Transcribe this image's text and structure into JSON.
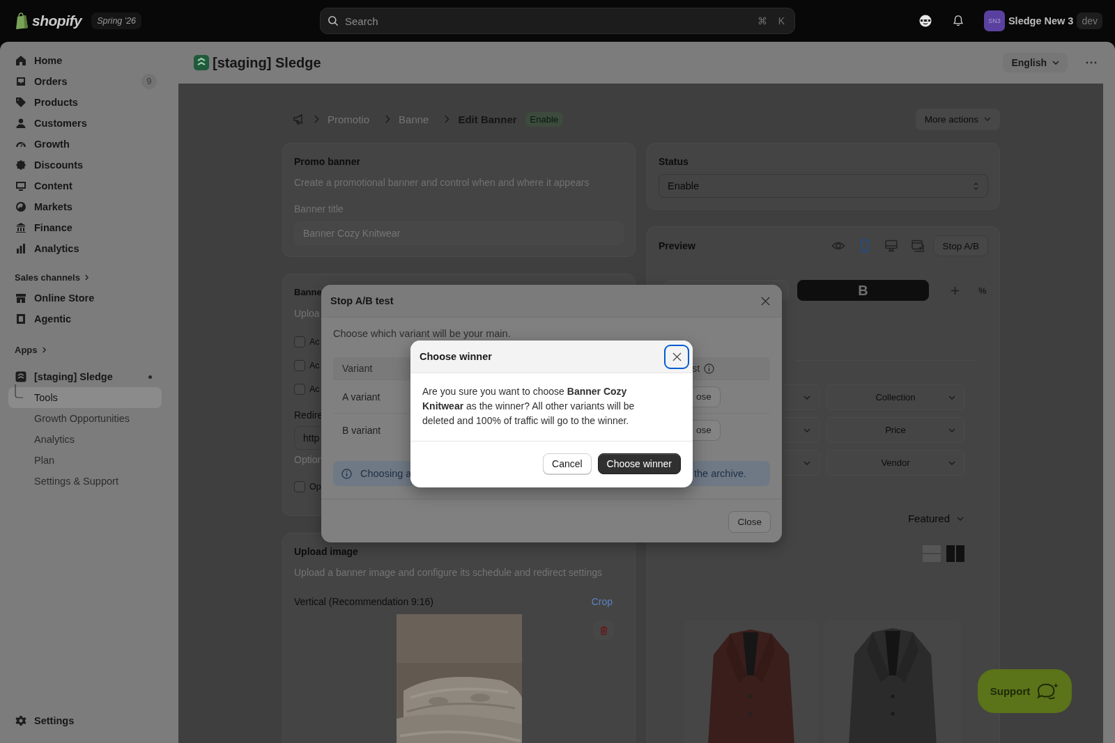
{
  "topbar": {
    "logo": "shopify",
    "edition": "Spring '26",
    "search": {
      "placeholder": "Search"
    },
    "shortcut": [
      "⌘",
      "K"
    ],
    "store": {
      "initials": "SN3",
      "name": "Sledge New 3",
      "badge": "dev"
    }
  },
  "sidebar": {
    "nav": [
      {
        "label": "Home",
        "selected": false
      },
      {
        "label": "Orders",
        "badge": "9",
        "selected": false
      },
      {
        "label": "Products",
        "selected": false
      },
      {
        "label": "Customers",
        "selected": false
      },
      {
        "label": "Growth",
        "selected": false
      },
      {
        "label": "Discounts",
        "selected": false
      },
      {
        "label": "Content",
        "selected": false
      },
      {
        "label": "Markets",
        "selected": false
      },
      {
        "label": "Finance",
        "selected": false
      },
      {
        "label": "Analytics",
        "selected": false
      }
    ],
    "sales_channels": {
      "heading": "Sales channels",
      "items": [
        {
          "label": "Online Store",
          "selected": false
        },
        {
          "label": "Agentic",
          "selected": false
        }
      ]
    },
    "apps": {
      "heading": "Apps"
    },
    "app": {
      "label": "[staging] Sledge",
      "children": [
        {
          "label": "Tools",
          "selected": true
        },
        {
          "label": "Growth Opportunities",
          "selected": false
        },
        {
          "label": "Analytics",
          "selected": false
        },
        {
          "label": "Plan",
          "selected": false
        },
        {
          "label": "Settings & Support",
          "selected": false
        }
      ]
    },
    "settings": {
      "label": "Settings"
    }
  },
  "page_header": {
    "title": "[staging] Sledge",
    "language": "English"
  },
  "breadcrumb": {
    "items": [
      "Promotio",
      "Banne"
    ],
    "current": "Edit Banner",
    "status": "Enable",
    "more_actions": "More actions"
  },
  "promo_card": {
    "title": "Promo banner",
    "description": "Create a promotional banner and control when and where it appears",
    "field_label": "Banner title",
    "field_value": "Banner Cozy Knitwear"
  },
  "settings_card": {
    "title": "Banne",
    "description": "Uploa",
    "checkboxes": [
      {
        "label": "Ac",
        "checked": false
      },
      {
        "label": "Ac",
        "checked": false
      },
      {
        "label": "Ac",
        "checked": false
      }
    ],
    "redirect_label": "Redire",
    "redirect_value": "http",
    "hint": "Option",
    "last_checkbox": {
      "label": "Op",
      "checked": false
    }
  },
  "upload_card": {
    "title": "Upload image",
    "description": "Upload a banner image and configure its schedule and redirect settings",
    "orientation": "Vertical (Recommendation 9:16)",
    "crop": "Crop"
  },
  "status_card": {
    "title": "Status",
    "value": "Enable"
  },
  "preview": {
    "title": "Preview",
    "views": [
      {
        "selected": false
      },
      {
        "selected": true
      },
      {
        "selected": false
      },
      {
        "selected": false
      }
    ],
    "stop_button": "Stop A/B",
    "variant_tabs": [
      {
        "selected": false
      },
      {
        "label": "B",
        "selected": true
      }
    ],
    "percent": "%",
    "filters": [
      {
        "label": "Collection"
      },
      {
        "label": "Price"
      },
      {
        "label": "Vendor"
      }
    ],
    "sort": "Featured",
    "layouts": [
      {
        "selected": false
      },
      {
        "selected": true
      }
    ]
  },
  "support": "Support",
  "stop_modal": {
    "title": "Stop A/B test",
    "intro": "Choose which variant will be your main.",
    "columns": [
      "Variant",
      "st"
    ],
    "rows": [
      {
        "variant": "A variant",
        "action": "ose"
      },
      {
        "variant": "B variant",
        "action": "ose"
      }
    ],
    "info_start": "Choosing a",
    "info_end": "the archive.",
    "close": "Close"
  },
  "winner_modal": {
    "title": "Choose winner",
    "message": "Are you sure you want to choose **Banner Cozy Knitwear** as the winner? All other variants will be deleted and 100% of traffic will go to the winner.",
    "cancel": "Cancel",
    "confirm": "Choose winner"
  }
}
